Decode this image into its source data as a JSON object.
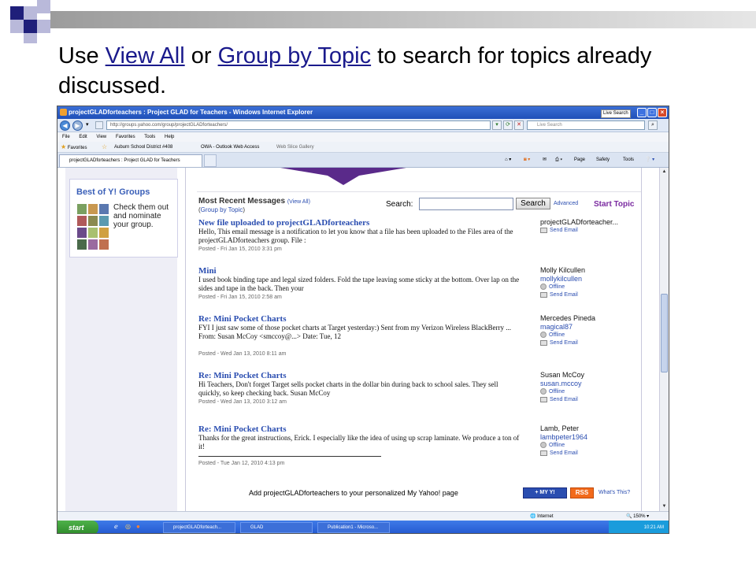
{
  "slide": {
    "title_pre": "Use ",
    "title_link1": "View All",
    "title_mid": " or ",
    "title_link2": "Group by Topic",
    "title_post": " to search for topics already discussed.",
    "colors": {
      "navy_square": "#1f1f7a",
      "light_square": "#b9b9da",
      "grey_bar": "#c8c8c8"
    }
  },
  "window": {
    "title": "projectGLADforteachers : Project GLAD for Teachers - Windows Internet Explorer",
    "live_search_tab": "Live Search",
    "address": "http://groups.yahoo.com/group/projectGLADforteachers/",
    "search_placeholder": "Live Search",
    "menu": [
      "File",
      "Edit",
      "View",
      "Favorites",
      "Tools",
      "Help"
    ],
    "favorites_label": "Favorites",
    "favorites_items": [
      "Auburn School District #408",
      "OWA - Outlook Web Access",
      "Web Slice Gallery"
    ],
    "tab_title": "projectGLADforteachers : Project GLAD for Teachers",
    "commands": [
      "Page",
      "Safety",
      "Tools"
    ]
  },
  "sidebar": {
    "best_title": "Best of Y! Groups",
    "best_text": "Check them out and nominate your group."
  },
  "messages_header": {
    "title": "Most Recent Messages",
    "view_all": "View All",
    "group_by_topic": "Group by Topic",
    "search_label": "Search:",
    "search_button": "Search",
    "advanced": "Advanced",
    "start_topic": "Start Topic"
  },
  "messages": [
    {
      "subject": "New file uploaded to projectGLADforteachers",
      "body": "Hello, This email message is a notification to let you know that a file has been uploaded to the Files area of the projectGLADforteachers group. File :",
      "posted": "Posted - Fri Jan 15, 2010 3:31 pm",
      "author_name": "projectGLADforteacher...",
      "author_id": "",
      "status": "",
      "send_email": "Send Email"
    },
    {
      "subject": "Mini",
      "body": "I used book binding tape and legal sized folders. Fold the tape leaving some sticky at the bottom. Over lap on the sides and tape in the back. Then your",
      "posted": "Posted - Fri Jan 15, 2010 2:58 am",
      "author_name": "Molly Kilcullen",
      "author_id": "mollykilcullen",
      "status": "Offline",
      "send_email": "Send Email"
    },
    {
      "subject": "Re: Mini Pocket Charts",
      "body": "FYI I just saw some of those pocket charts at Target yesterday:) Sent from my Verizon Wireless BlackBerry ... From: Susan McCoy <smccoy@...> Date: Tue, 12",
      "posted": "Posted - Wed Jan 13, 2010 8:11 am",
      "author_name": "Mercedes Pineda",
      "author_id": "magical87",
      "status": "Offline",
      "send_email": "Send Email"
    },
    {
      "subject": "Re: Mini Pocket Charts",
      "body": "Hi Teachers, Don't forget Target sells pocket charts in the dollar bin during back to school sales. They sell quickly, so keep checking back. Susan McCoy",
      "posted": "Posted - Wed Jan 13, 2010 3:12 am",
      "author_name": "Susan McCoy",
      "author_id": "susan.mccoy",
      "status": "Offline",
      "send_email": "Send Email"
    },
    {
      "subject": "Re: Mini Pocket Charts",
      "body": "Thanks for the great instructions, Erick. I especially like the idea of using up scrap laminate. We produce a ton of it!",
      "posted": "Posted - Tue Jan 12, 2010 4:13 pm",
      "author_name": "Lamb, Peter",
      "author_id": "lambpeter1964",
      "status": "Offline",
      "send_email": "Send Email"
    }
  ],
  "footer": {
    "add_text": "Add projectGLADforteachers to your personalized My Yahoo! page",
    "myy_button": "+ MY Y!",
    "rss_button": "RSS",
    "whats_this": "What's This?"
  },
  "statusbar": {
    "zone": "Internet",
    "zoom": "150%"
  },
  "taskbar": {
    "start": "start",
    "tasks": [
      "projectGLADforteach...",
      "GLAD",
      "Publication1 - Microso..."
    ],
    "clock": "10:21 AM"
  },
  "icons": [
    "ie-icon",
    "back-icon",
    "forward-icon",
    "refresh-icon",
    "stop-icon",
    "star-icon",
    "home-icon",
    "rss-icon",
    "print-icon",
    "help-icon",
    "envelope-icon",
    "presence-icon",
    "windows-logo-icon"
  ]
}
